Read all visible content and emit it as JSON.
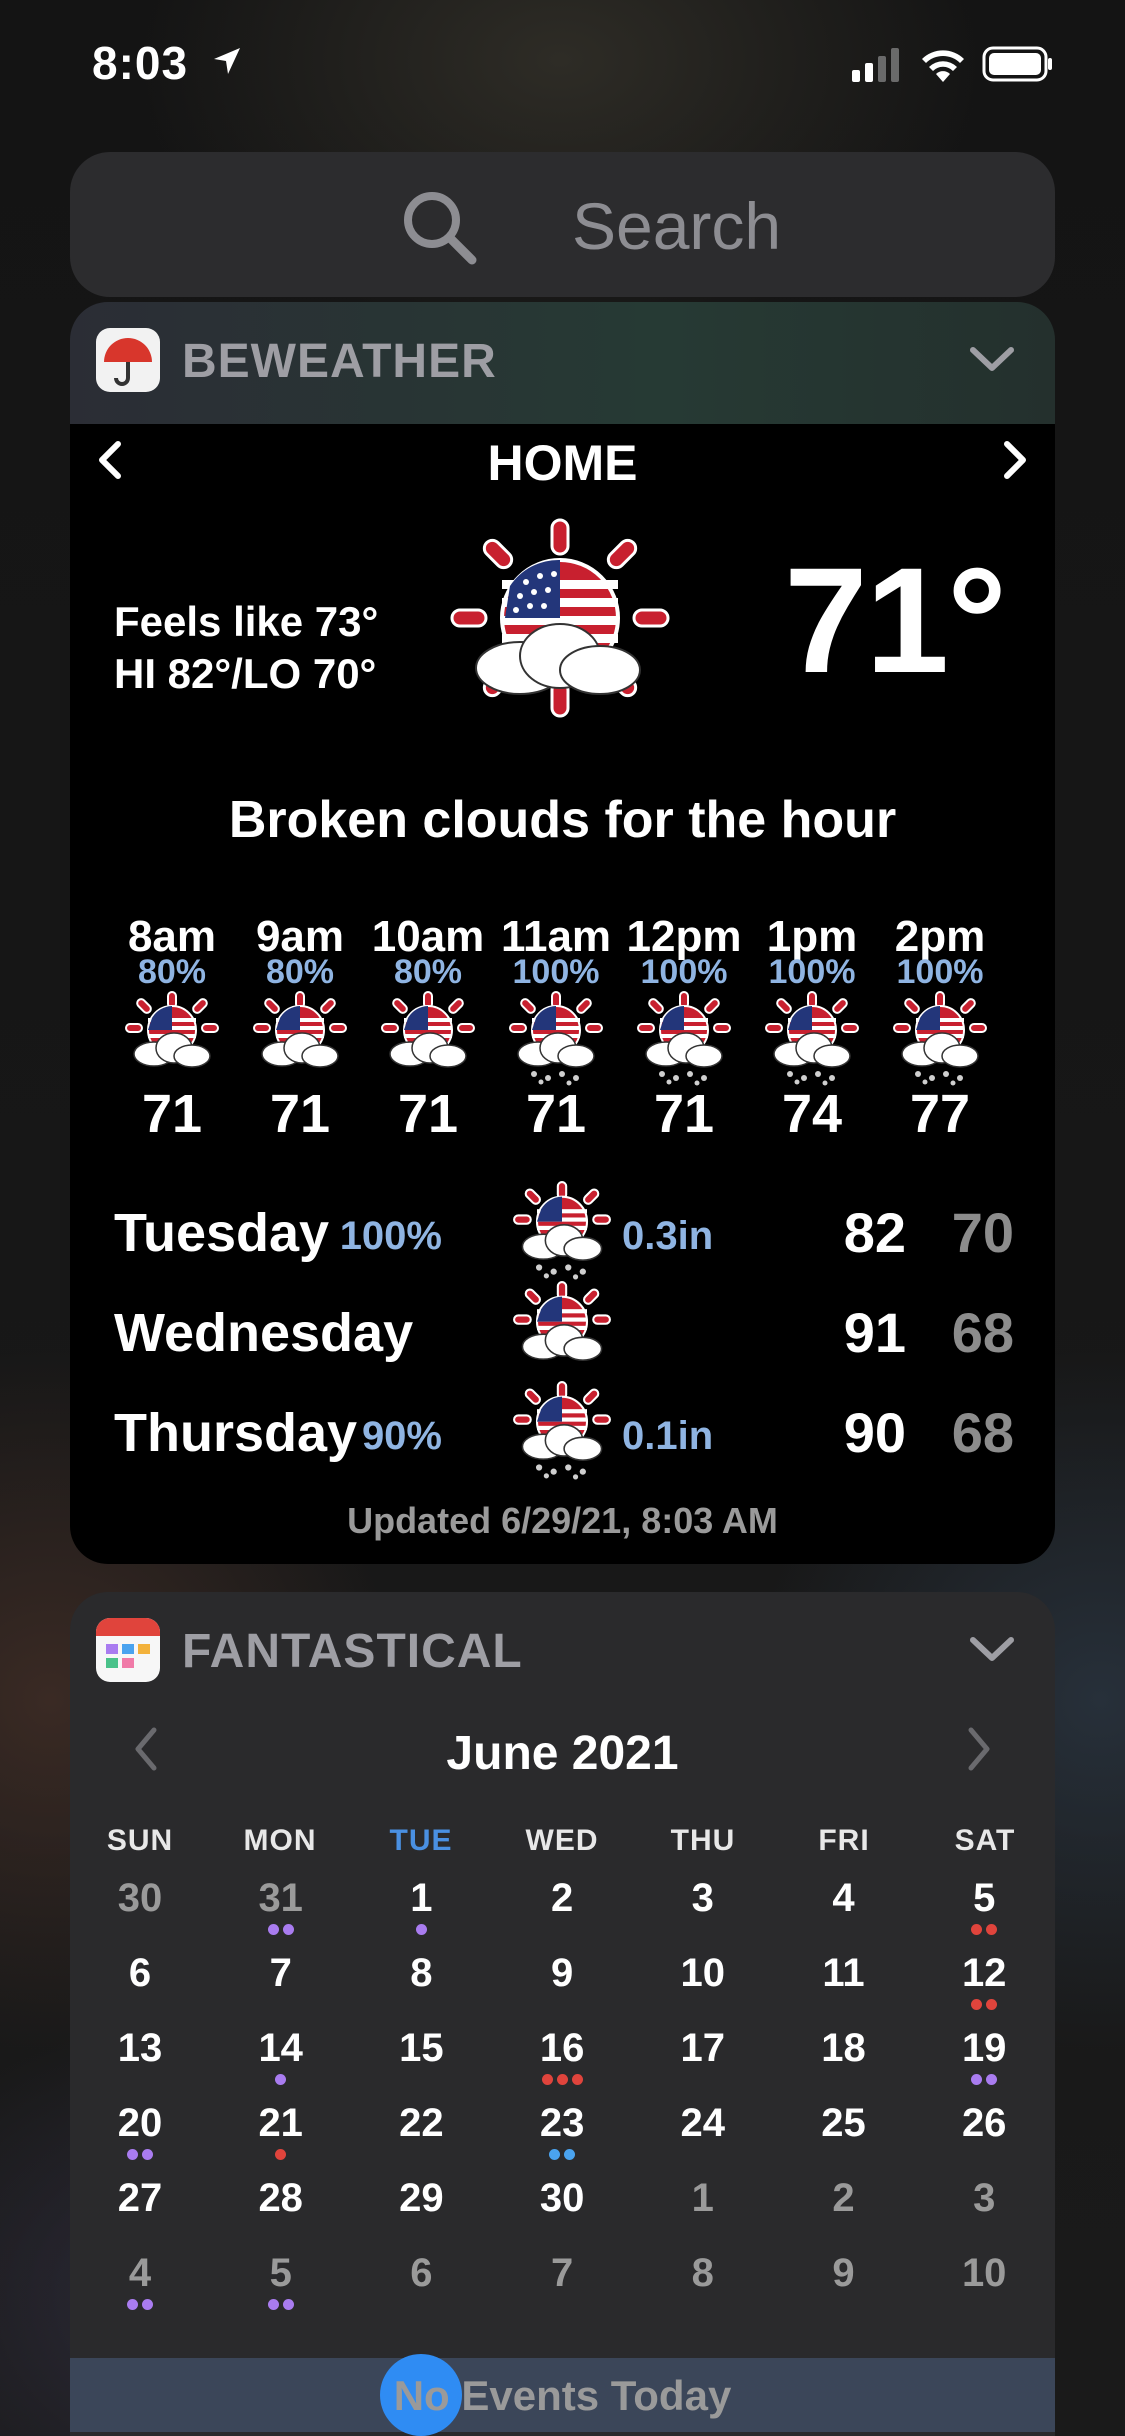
{
  "status_bar": {
    "time": "8:03"
  },
  "search": {
    "placeholder": "Search"
  },
  "beweather": {
    "app_title": "BEWEATHER",
    "location": "HOME",
    "feels_like": "Feels like 73°",
    "hi_lo": "HI 82°/LO 70°",
    "current_temp": "71°",
    "summary": "Broken clouds for the hour",
    "hourly": [
      {
        "time": "8am",
        "precip": "80%",
        "temp": "71"
      },
      {
        "time": "9am",
        "precip": "80%",
        "temp": "71"
      },
      {
        "time": "10am",
        "precip": "80%",
        "temp": "71"
      },
      {
        "time": "11am",
        "precip": "100%",
        "temp": "71"
      },
      {
        "time": "12pm",
        "precip": "100%",
        "temp": "71"
      },
      {
        "time": "1pm",
        "precip": "100%",
        "temp": "74"
      },
      {
        "time": "2pm",
        "precip": "100%",
        "temp": "77"
      }
    ],
    "daily": [
      {
        "day": "Tuesday",
        "precip": "100%",
        "rain": "0.3in",
        "hi": "82",
        "lo": "70"
      },
      {
        "day": "Wednesday",
        "precip": "",
        "rain": "",
        "hi": "91",
        "lo": "68"
      },
      {
        "day": "Thursday",
        "precip": "90%",
        "rain": "0.1in",
        "hi": "90",
        "lo": "68"
      }
    ],
    "updated": "Updated 6/29/21, 8:03 AM"
  },
  "fantastical": {
    "app_title": "FANTASTICAL",
    "month": "June 2021",
    "weekdays": [
      "SUN",
      "MON",
      "TUE",
      "WED",
      "THU",
      "FRI",
      "SAT"
    ],
    "weeks": [
      [
        "30",
        "31",
        "1",
        "2",
        "3",
        "4",
        "5"
      ],
      [
        "6",
        "7",
        "8",
        "9",
        "10",
        "11",
        "12"
      ],
      [
        "13",
        "14",
        "15",
        "16",
        "17",
        "18",
        "19"
      ],
      [
        "20",
        "21",
        "22",
        "23",
        "24",
        "25",
        "26"
      ],
      [
        "27",
        "28",
        "29",
        "30",
        "1",
        "2",
        "3"
      ],
      [
        "4",
        "5",
        "6",
        "7",
        "8",
        "9",
        "10"
      ]
    ],
    "today": "29",
    "no_events": "No Events Today",
    "colors": {
      "purple": "#a97cf0",
      "red": "#e0443c",
      "blue": "#4aa3ef",
      "today": "#2f8cf3"
    }
  }
}
